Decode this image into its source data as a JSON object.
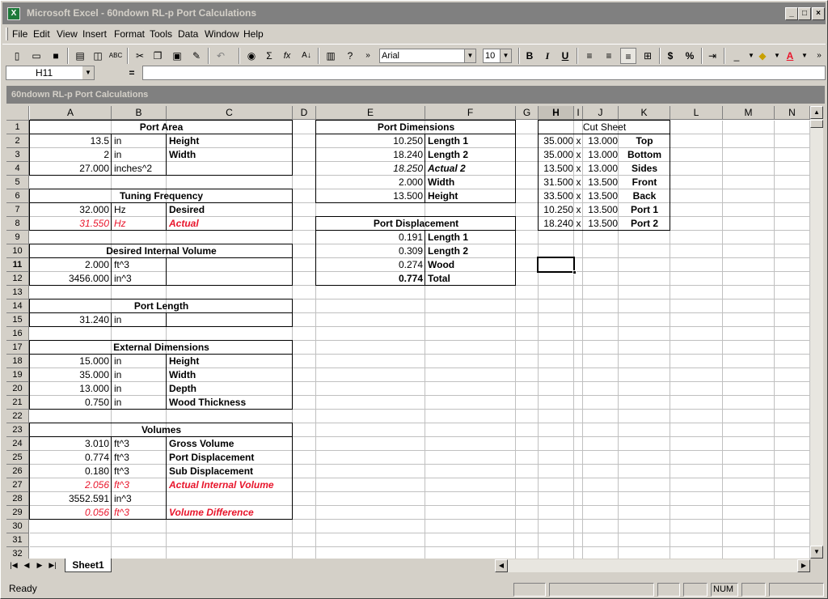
{
  "window": {
    "title": "Microsoft Excel - 60ndown RL-p Port Calculations",
    "workbook_title": "60ndown RL-p Port Calculations"
  },
  "menu": [
    "File",
    "Edit",
    "View",
    "Insert",
    "Format",
    "Tools",
    "Data",
    "Window",
    "Help"
  ],
  "toolbar": {
    "font_name": "Arial",
    "font_size": "10",
    "icons": [
      "new-icon",
      "open-icon",
      "save-icon",
      "print-icon",
      "print-preview-icon",
      "spelling-icon",
      "cut-icon",
      "copy-icon",
      "paste-icon",
      "format-painter-icon",
      "undo-icon",
      "hyperlink-icon",
      "autosum-icon",
      "function-icon",
      "sort-ascending-icon",
      "chart-wizard-icon",
      "help-icon"
    ],
    "autosum_glyph": "Σ",
    "fx_glyph": "fx",
    "bold": "B",
    "italic": "I",
    "underline": "U",
    "currency": "$",
    "percent": "%"
  },
  "formula_bar": {
    "name_box": "H11",
    "equals": "=",
    "content": ""
  },
  "columns": [
    "A",
    "B",
    "C",
    "D",
    "E",
    "F",
    "G",
    "H",
    "I",
    "J",
    "K",
    "L",
    "M",
    "N"
  ],
  "selected_column": "H",
  "selected_row": "11",
  "rows": [
    "1",
    "2",
    "3",
    "4",
    "5",
    "6",
    "7",
    "8",
    "9",
    "10",
    "11",
    "12",
    "13",
    "14",
    "15",
    "16",
    "17",
    "18",
    "19",
    "20",
    "21",
    "22",
    "23",
    "24",
    "25",
    "26",
    "27",
    "28",
    "29",
    "30",
    "31",
    "32"
  ],
  "sections": {
    "port_area": {
      "title": "Port Area",
      "rows": [
        [
          "13.5",
          "in",
          "Height"
        ],
        [
          "2",
          "in",
          "Width"
        ],
        [
          "27.000",
          "inches^2",
          ""
        ]
      ]
    },
    "tuning": {
      "title": "Tuning Frequency",
      "rows": [
        [
          "32.000",
          "Hz",
          "Desired"
        ],
        [
          "31.550",
          "Hz",
          "Actual"
        ]
      ]
    },
    "desired_volume": {
      "title": "Desired Internal Volume",
      "rows": [
        [
          "2.000",
          "ft^3",
          ""
        ],
        [
          "3456.000",
          "in^3",
          ""
        ]
      ]
    },
    "port_length": {
      "title": "Port Length",
      "rows": [
        [
          "31.240",
          "in",
          ""
        ]
      ]
    },
    "external_dims": {
      "title": "External Dimensions",
      "rows": [
        [
          "15.000",
          "in",
          "Height"
        ],
        [
          "35.000",
          "in",
          "Width"
        ],
        [
          "13.000",
          "in",
          "Depth"
        ],
        [
          "0.750",
          "in",
          "Wood Thickness"
        ]
      ]
    },
    "volumes": {
      "title": "Volumes",
      "rows": [
        [
          "3.010",
          "ft^3",
          "Gross Volume"
        ],
        [
          "0.774",
          "ft^3",
          "Port Displacement"
        ],
        [
          "0.180",
          "ft^3",
          "Sub Displacement"
        ],
        [
          "2.056",
          "ft^3",
          "Actual Internal Volume"
        ],
        [
          "3552.591",
          "in^3",
          ""
        ],
        [
          "0.056",
          "ft^3",
          "Volume Difference"
        ]
      ]
    },
    "port_dims": {
      "title": "Port Dimensions",
      "rows": [
        [
          "10.250",
          "Length 1"
        ],
        [
          "18.240",
          "Length 2"
        ],
        [
          "18.250",
          "Actual 2"
        ],
        [
          "2.000",
          "Width"
        ],
        [
          "13.500",
          "Height"
        ]
      ]
    },
    "port_disp": {
      "title": "Port Displacement",
      "rows": [
        [
          "0.191",
          "Length 1"
        ],
        [
          "0.309",
          "Length 2"
        ],
        [
          "0.274",
          "Wood"
        ],
        [
          "0.774",
          "Total"
        ]
      ]
    },
    "cut_sheet": {
      "title": "Cut Sheet",
      "x": "x",
      "rows": [
        [
          "35.000",
          "13.000",
          "Top"
        ],
        [
          "35.000",
          "13.000",
          "Bottom"
        ],
        [
          "13.500",
          "13.000",
          "Sides"
        ],
        [
          "31.500",
          "13.500",
          "Front"
        ],
        [
          "33.500",
          "13.500",
          "Back"
        ],
        [
          "10.250",
          "13.500",
          "Port 1"
        ],
        [
          "18.240",
          "13.500",
          "Port 2"
        ]
      ]
    }
  },
  "sheet_tab": "Sheet1",
  "status": {
    "text": "Ready",
    "num": "NUM"
  },
  "colors": {
    "red_text": "#e8152b",
    "title_inactive": "#808080",
    "face": "#d4d0c8"
  }
}
